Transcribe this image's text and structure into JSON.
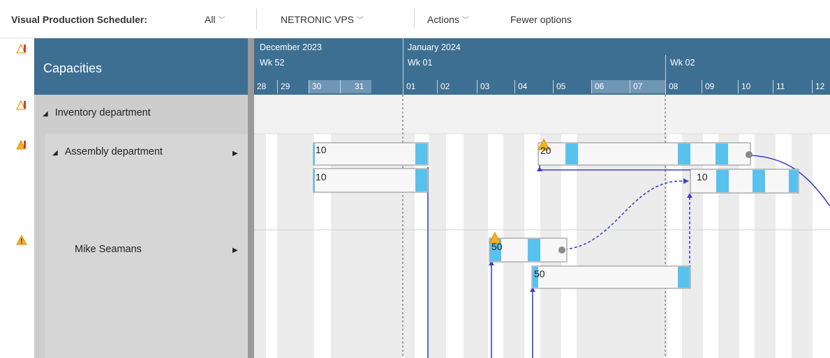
{
  "toolbar": {
    "title": "Visual Production Scheduler:",
    "filter": "All",
    "view": "NETRONIC VPS",
    "actions": "Actions",
    "fewer_options": "Fewer options"
  },
  "capacities_header": "Capacities",
  "timeline": {
    "months": [
      "December 2023",
      "January 2024"
    ],
    "weeks": [
      "Wk 52",
      "Wk 01",
      "Wk 02"
    ],
    "days": [
      "28",
      "29",
      "30",
      "31",
      "01",
      "02",
      "03",
      "04",
      "05",
      "06",
      "07",
      "08",
      "09",
      "10",
      "11",
      "12"
    ]
  },
  "resources": [
    {
      "name": "Inventory department",
      "level": 0
    },
    {
      "name": "Assembly department",
      "level": 1
    },
    {
      "name": "Mike Seamans",
      "level": 2
    }
  ],
  "bars": [
    {
      "label": "10"
    },
    {
      "label": "10"
    },
    {
      "label": "20"
    },
    {
      "label": "10"
    },
    {
      "label": "50"
    },
    {
      "label": "50"
    }
  ],
  "colors": {
    "header_blue": "#3d6f93",
    "weekend_header": "#6f96b5",
    "bar_accent": "#58c2ef",
    "link_line": "#3b3fd0",
    "warning": "#f2b31e"
  }
}
